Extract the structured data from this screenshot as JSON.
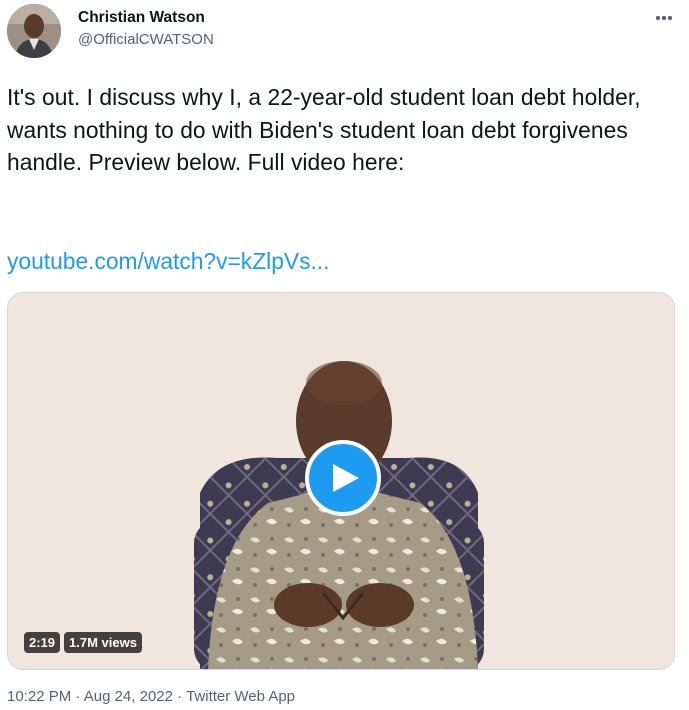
{
  "author": {
    "name": "Christian Watson",
    "handle": "@OfficialCWATSON"
  },
  "tweet": {
    "text": "It's out. I discuss why I, a 22-year-old student loan debt holder, wants nothing to do with Biden's student loan debt forgivenes handle. Preview below. Full video here:",
    "link": "youtube.com/watch?v=kZlpVs..."
  },
  "video": {
    "duration": "2:19",
    "views": "1.7M views"
  },
  "meta": {
    "time": "10:22 PM",
    "separator": "·",
    "date": "Aug 24, 2022",
    "source": "Twitter Web App"
  },
  "icons": {
    "more": "more-horizontal-icon",
    "play": "play-icon"
  },
  "colors": {
    "accent": "#1d9bf0",
    "secondary_text": "#536471",
    "primary_text": "#0f1419"
  }
}
